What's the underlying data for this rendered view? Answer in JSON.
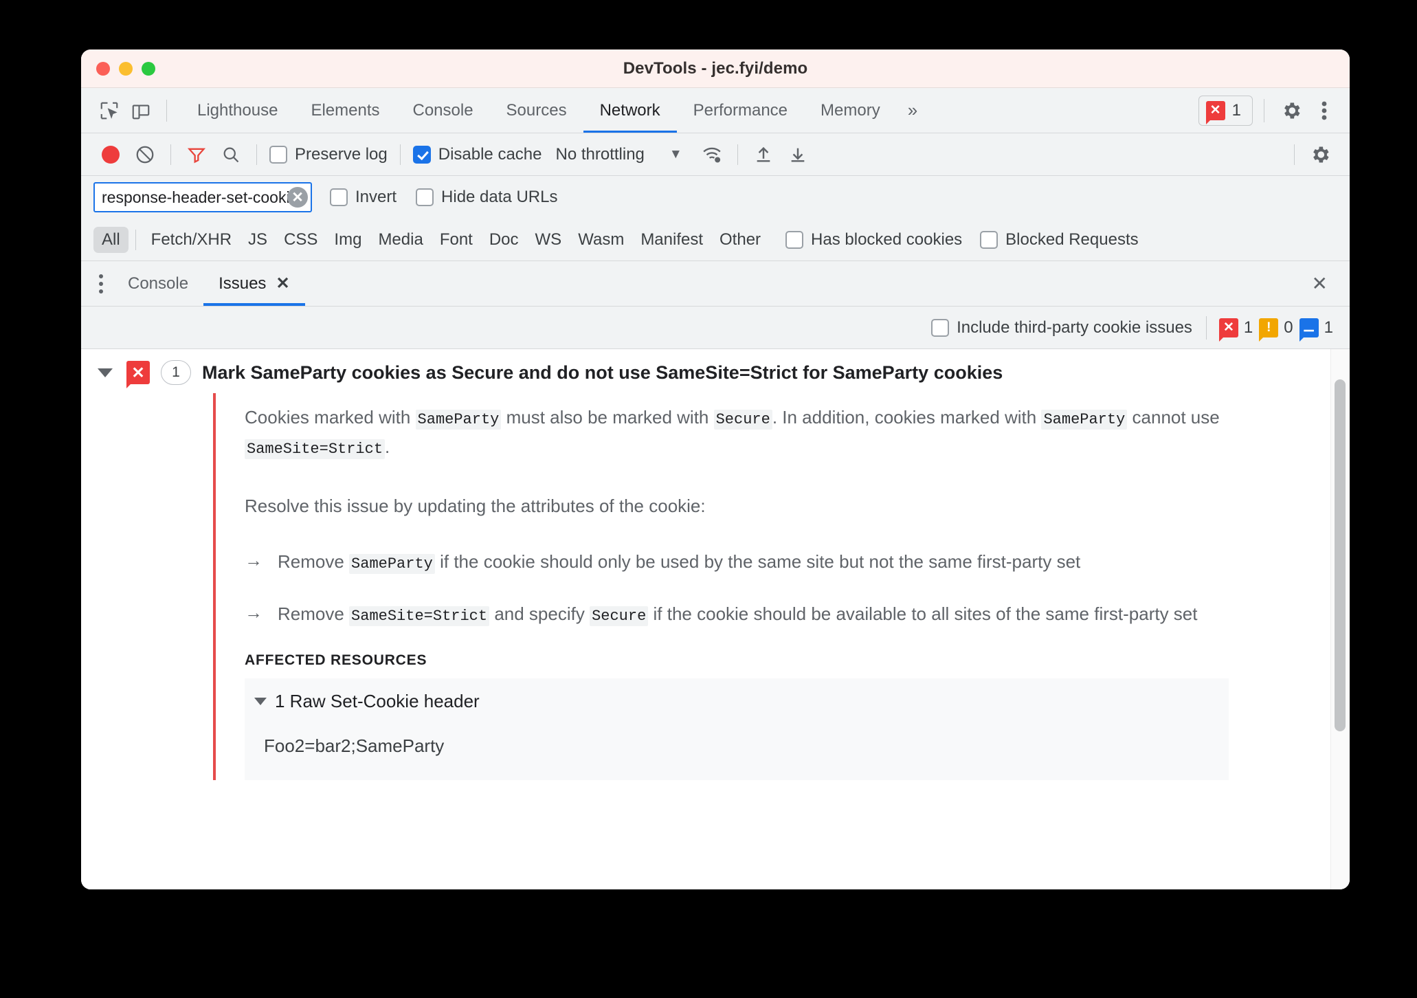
{
  "window": {
    "title": "DevTools - jec.fyi/demo",
    "traffic_lights": [
      "close",
      "minimize",
      "maximize"
    ]
  },
  "main_tabs": {
    "inspect_icon": "inspect-element-icon",
    "device_icon": "device-toolbar-icon",
    "items": [
      {
        "label": "Lighthouse",
        "active": false
      },
      {
        "label": "Elements",
        "active": false
      },
      {
        "label": "Console",
        "active": false
      },
      {
        "label": "Sources",
        "active": false
      },
      {
        "label": "Network",
        "active": true
      },
      {
        "label": "Performance",
        "active": false
      },
      {
        "label": "Memory",
        "active": false
      }
    ],
    "overflow_label": "»",
    "error_pill_count": "1",
    "settings_icon": "gear-icon",
    "more_icon": "kebab-menu-icon"
  },
  "network_toolbar": {
    "record_icon": "record-icon",
    "clear_icon": "clear-icon",
    "filter_icon": "filter-icon",
    "search_icon": "search-icon",
    "preserve_log": {
      "label": "Preserve log",
      "checked": false
    },
    "disable_cache": {
      "label": "Disable cache",
      "checked": true
    },
    "throttling": {
      "value": "No throttling",
      "caret": "▼"
    },
    "network_conditions_icon": "wifi-settings-icon",
    "upload_icon": "import-har-icon",
    "download_icon": "export-har-icon",
    "settings_icon": "gear-icon"
  },
  "filter_row": {
    "input_value": "response-header-set-cooki",
    "input_placeholder": "Filter",
    "clear_icon": "clear-input-icon",
    "invert": {
      "label": "Invert",
      "checked": false
    },
    "hide_data_urls": {
      "label": "Hide data URLs",
      "checked": false
    }
  },
  "type_filters": {
    "all": "All",
    "types": [
      "Fetch/XHR",
      "JS",
      "CSS",
      "Img",
      "Media",
      "Font",
      "Doc",
      "WS",
      "Wasm",
      "Manifest",
      "Other"
    ],
    "has_blocked_cookies": {
      "label": "Has blocked cookies",
      "checked": false
    },
    "blocked_requests": {
      "label": "Blocked Requests",
      "checked": false
    }
  },
  "drawer": {
    "menu_icon": "kebab-menu-icon",
    "tabs": [
      {
        "label": "Console",
        "active": false,
        "closable": false
      },
      {
        "label": "Issues",
        "active": true,
        "closable": true,
        "close_icon": "✕"
      }
    ],
    "close_icon": "✕"
  },
  "issues_toolbar": {
    "include_third_party": {
      "label": "Include third-party cookie issues",
      "checked": false
    },
    "counts": {
      "errors": "1",
      "warnings": "0",
      "info": "1"
    }
  },
  "issue": {
    "expand_icon": "collapse-triangle-icon",
    "severity_icon": "error-icon",
    "count": "1",
    "title": "Mark SameParty cookies as Secure and do not use SameSite=Strict for SameParty cookies",
    "paragraph1": {
      "p1": "Cookies marked with ",
      "c1": "SameParty",
      "p2": " must also be marked with ",
      "c2": "Secure",
      "p3": ". In addition, cookies marked with ",
      "c3": "SameParty",
      "p4": " cannot use ",
      "c4": "SameSite=Strict",
      "p5": "."
    },
    "paragraph2": "Resolve this issue by updating the attributes of the cookie:",
    "bullets": [
      {
        "arrow": "→",
        "p1": "Remove ",
        "c1": "SameParty",
        "p2": " if the cookie should only be used by the same site but not the same first-party set"
      },
      {
        "arrow": "→",
        "p1": "Remove ",
        "c1": "SameSite=Strict",
        "p2": " and specify ",
        "c2": "Secure",
        "p3": " if the cookie should be available to all sites of the same first-party set"
      }
    ],
    "affected_label": "AFFECTED RESOURCES",
    "affected_row": "1 Raw Set-Cookie header",
    "affected_value": "Foo2=bar2;SameParty"
  },
  "colors": {
    "accent_blue": "#1a73e8",
    "error_red": "#ee3c3c",
    "warning_orange": "#f2a600",
    "titlebar_pink": "#fdf1ef",
    "toolbar_grey": "#f1f3f4"
  }
}
